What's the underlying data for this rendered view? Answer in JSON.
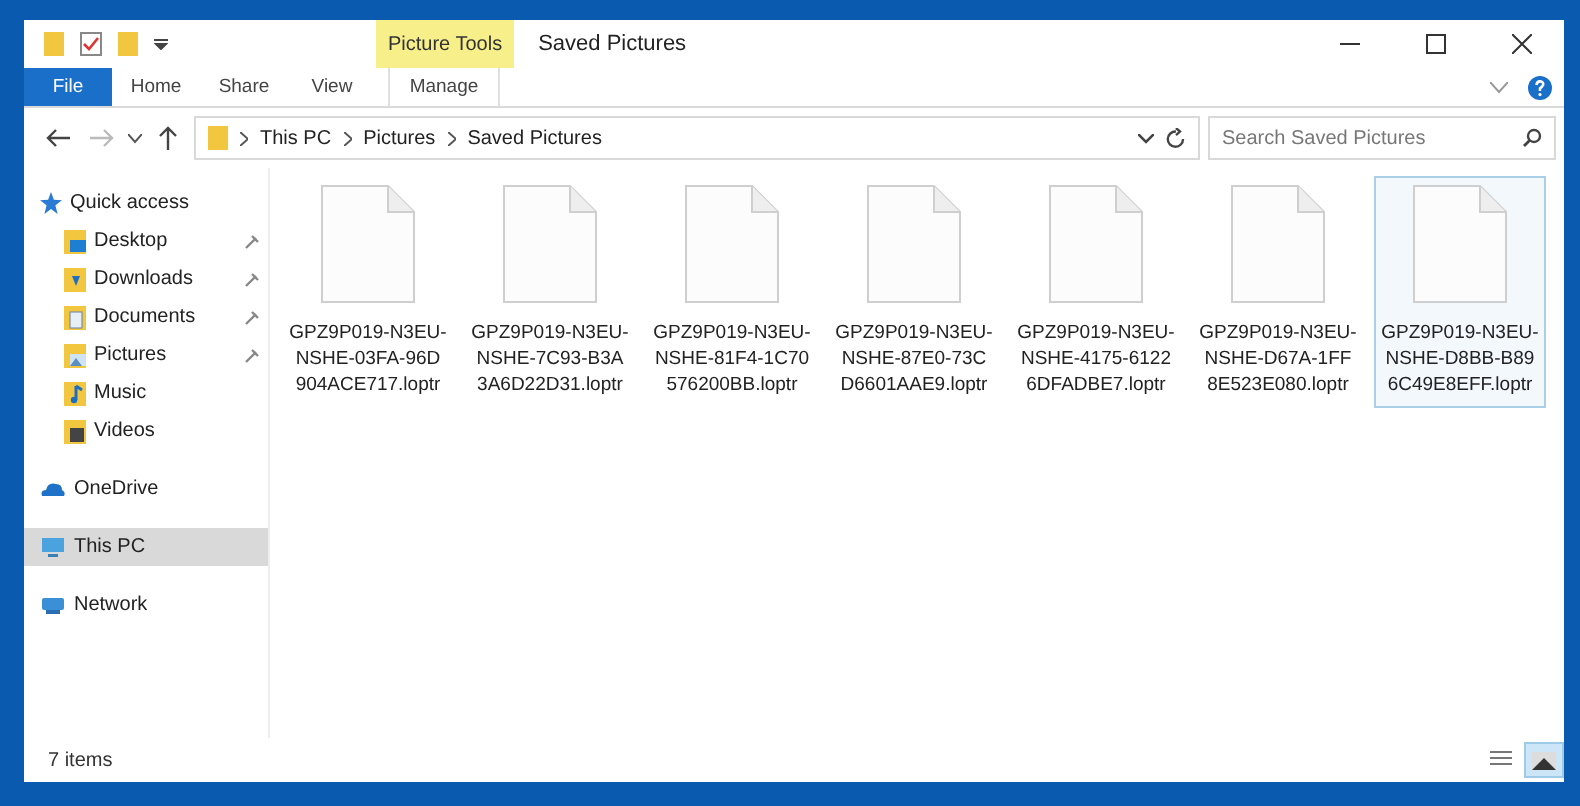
{
  "window": {
    "title": "Saved Pictures",
    "context_tab": "Picture Tools"
  },
  "ribbon_tabs": [
    {
      "label": "File",
      "kind": "file"
    },
    {
      "label": "Home",
      "kind": "tab"
    },
    {
      "label": "Share",
      "kind": "tab"
    },
    {
      "label": "View",
      "kind": "tab"
    },
    {
      "label": "Manage",
      "kind": "context"
    }
  ],
  "address": {
    "crumbs": [
      "This PC",
      "Pictures",
      "Saved Pictures"
    ]
  },
  "search": {
    "placeholder": "Search Saved Pictures"
  },
  "sidebar": {
    "items": [
      {
        "label": "Quick access",
        "kind": "star",
        "selected": false,
        "children": [
          {
            "label": "Desktop",
            "kind": "desktop",
            "pinned": true,
            "selected": false
          },
          {
            "label": "Downloads",
            "kind": "downloads",
            "pinned": true,
            "selected": false
          },
          {
            "label": "Documents",
            "kind": "documents",
            "pinned": true,
            "selected": false
          },
          {
            "label": "Pictures",
            "kind": "pictures",
            "pinned": true,
            "selected": false
          },
          {
            "label": "Music",
            "kind": "music",
            "pinned": false,
            "selected": false
          },
          {
            "label": "Videos",
            "kind": "videos",
            "pinned": false,
            "selected": false
          }
        ]
      },
      {
        "label": "OneDrive",
        "kind": "cloud",
        "selected": false
      },
      {
        "label": "This PC",
        "kind": "pc",
        "selected": true
      },
      {
        "label": "Network",
        "kind": "network",
        "selected": false
      }
    ]
  },
  "files": [
    {
      "name": [
        "GPZ9P019-N3EU-",
        "NSHE-03FA-96D",
        "904ACE717.loptr"
      ],
      "selected": false
    },
    {
      "name": [
        "GPZ9P019-N3EU-",
        "NSHE-7C93-B3A",
        "3A6D22D31.loptr"
      ],
      "selected": false
    },
    {
      "name": [
        "GPZ9P019-N3EU-",
        "NSHE-81F4-1C70",
        "576200BB.loptr"
      ],
      "selected": false
    },
    {
      "name": [
        "GPZ9P019-N3EU-",
        "NSHE-87E0-73C",
        "D6601AAE9.loptr"
      ],
      "selected": false
    },
    {
      "name": [
        "GPZ9P019-N3EU-",
        "NSHE-4175-6122",
        "6DFADBE7.loptr"
      ],
      "selected": false
    },
    {
      "name": [
        "GPZ9P019-N3EU-",
        "NSHE-D67A-1FF",
        "8E523E080.loptr"
      ],
      "selected": false
    },
    {
      "name": [
        "GPZ9P019-N3EU-",
        "NSHE-D8BB-B89",
        "6C49E8EFF.loptr"
      ],
      "selected": true
    }
  ],
  "status_bar": {
    "count": "7 items",
    "view_buttons": [
      {
        "kind": "details",
        "selected": false
      },
      {
        "kind": "large-icons",
        "selected": true
      }
    ]
  }
}
